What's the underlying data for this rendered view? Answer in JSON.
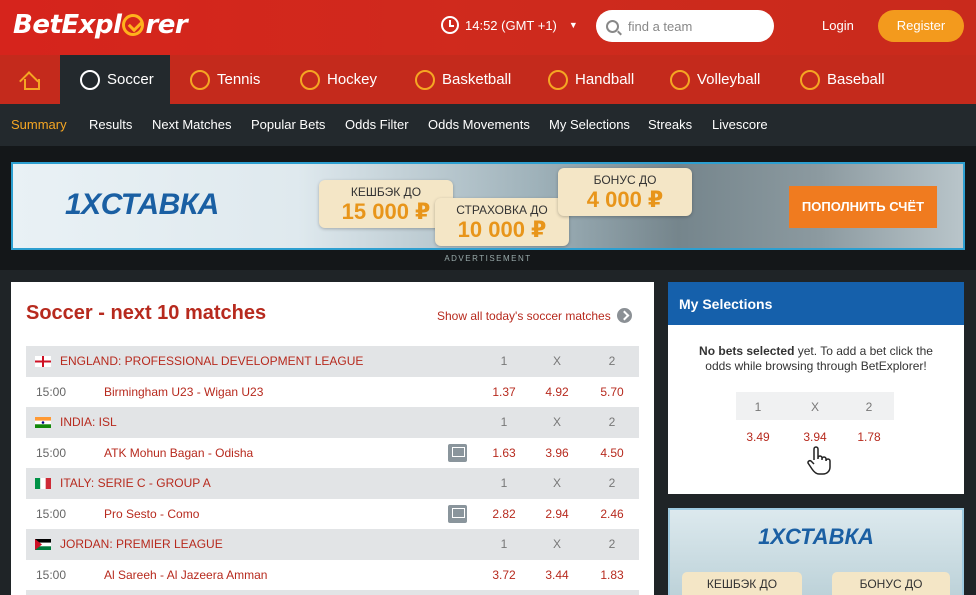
{
  "header": {
    "logo": "BetExplorer",
    "time": "14:52 (GMT +1)",
    "search_placeholder": "find a team",
    "login": "Login",
    "register": "Register"
  },
  "sports_nav": [
    {
      "label": "",
      "icon": "home-icon"
    },
    {
      "label": "Soccer",
      "icon": "soccer-ball-icon",
      "active": true
    },
    {
      "label": "Tennis",
      "icon": "tennis-racket-icon"
    },
    {
      "label": "Hockey",
      "icon": "hockey-stick-icon"
    },
    {
      "label": "Basketball",
      "icon": "basketball-icon"
    },
    {
      "label": "Handball",
      "icon": "handball-icon"
    },
    {
      "label": "Volleyball",
      "icon": "volleyball-icon"
    },
    {
      "label": "Baseball",
      "icon": "baseball-bat-icon"
    }
  ],
  "sub_nav": [
    "Summary",
    "Results",
    "Next Matches",
    "Popular Bets",
    "Odds Filter",
    "Odds Movements",
    "My Selections",
    "Streaks",
    "Livescore"
  ],
  "ad": {
    "brand": "1XСТАВКА",
    "card1_title": "КЕШБЭК ДО",
    "card1_value": "15 000 ₽",
    "card2_title": "СТРАХОВКА ДО",
    "card2_value": "10 000 ₽",
    "card3_title": "БОНУС ДО",
    "card3_value": "4 000 ₽",
    "button": "ПОПОЛНИТЬ СЧЁТ",
    "label": "ADVERTISEMENT"
  },
  "main": {
    "title": "Soccer - next 10 matches",
    "show_all": "Show all today's soccer matches",
    "col1": "1",
    "colx": "X",
    "col2": "2",
    "leagues": [
      {
        "name": "ENGLAND: PROFESSIONAL DEVELOPMENT LEAGUE",
        "flag": "england",
        "match": {
          "time": "15:00",
          "teams": "Birmingham U23 - Wigan U23",
          "tv": false,
          "o1": "1.37",
          "ox": "4.92",
          "o2": "5.70"
        }
      },
      {
        "name": "INDIA: ISL",
        "flag": "india",
        "match": {
          "time": "15:00",
          "teams": "ATK Mohun Bagan - Odisha",
          "tv": true,
          "o1": "1.63",
          "ox": "3.96",
          "o2": "4.50"
        }
      },
      {
        "name": "ITALY: SERIE C - GROUP A",
        "flag": "italy",
        "match": {
          "time": "15:00",
          "teams": "Pro Sesto - Como",
          "tv": true,
          "o1": "2.82",
          "ox": "2.94",
          "o2": "2.46"
        }
      },
      {
        "name": "JORDAN: PREMIER LEAGUE",
        "flag": "jordan",
        "match": {
          "time": "15:00",
          "teams": "Al Sareeh - Al Jazeera Amman",
          "tv": false,
          "o1": "3.72",
          "ox": "3.44",
          "o2": "1.83"
        }
      }
    ]
  },
  "selections": {
    "title": "My Selections",
    "text_bold": "No bets selected",
    "text_rest": " yet. To add a bet click the odds while browsing through BetExplorer!",
    "h1": "1",
    "hx": "X",
    "h2": "2",
    "o1": "3.49",
    "ox": "3.94",
    "o2": "1.78"
  },
  "ad2": {
    "brand": "1XСТАВКА",
    "card1": "КЕШБЭК ДО",
    "card2": "БОНУС ДО"
  },
  "colors": {
    "brand_red": "#d6241c",
    "accent_orange": "#f39a1d",
    "dark_nav": "#23292d",
    "link_red": "#b72a1e",
    "selection_blue": "#1560ab"
  }
}
